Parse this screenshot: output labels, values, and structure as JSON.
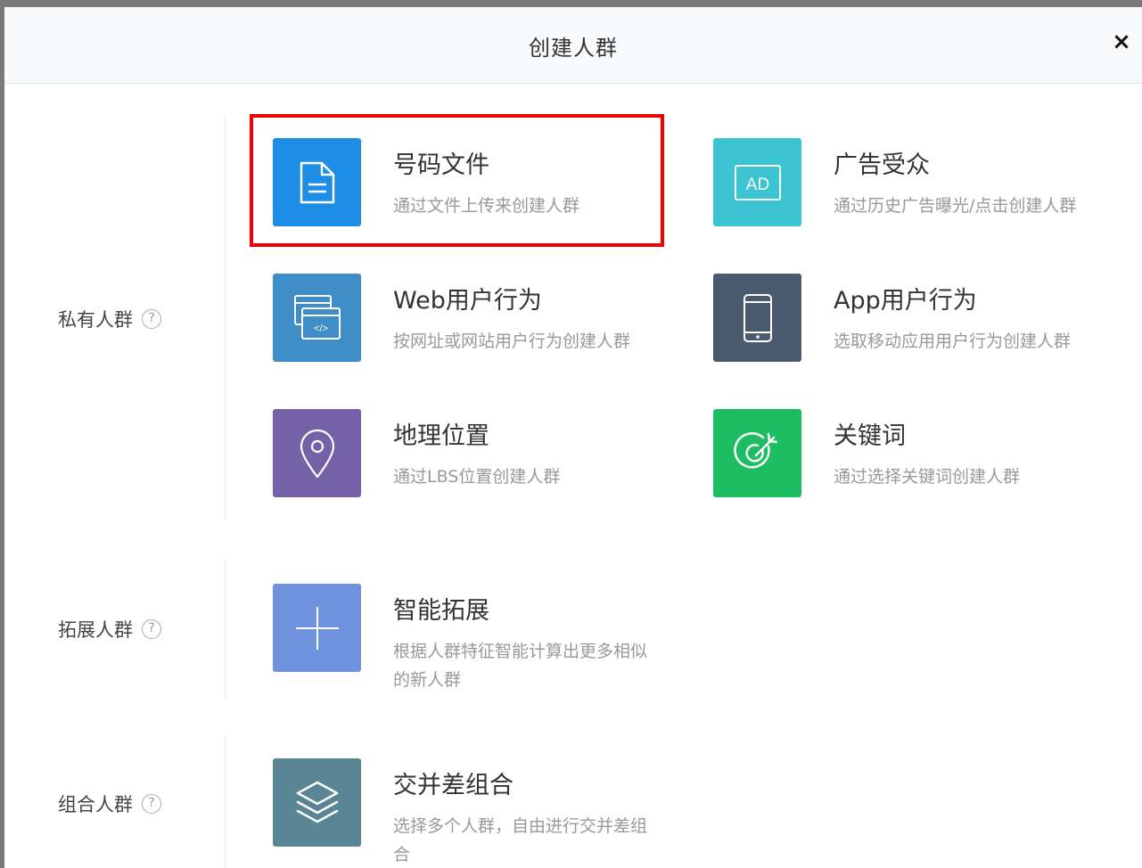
{
  "dialog": {
    "title": "创建人群",
    "close_label": "×"
  },
  "sections": {
    "private": {
      "label": "私有人群",
      "help": "?"
    },
    "expand": {
      "label": "拓展人群",
      "help": "?"
    },
    "combine": {
      "label": "组合人群",
      "help": "?"
    }
  },
  "cards": {
    "number_file": {
      "title": "号码文件",
      "desc": "通过文件上传来创建人群",
      "icon": "document-icon",
      "color": "#1e8de6"
    },
    "ad_audience": {
      "title": "广告受众",
      "desc": "通过历史广告曝光/点击创建人群",
      "icon": "ad-icon",
      "icon_text": "AD",
      "color": "#3cc4d2"
    },
    "web_behavior": {
      "title": "Web用户行为",
      "desc": "按网址或网站用户行为创建人群",
      "icon": "browser-code-icon",
      "icon_text": "</>",
      "color": "#3f8ec8"
    },
    "app_behavior": {
      "title": "App用户行为",
      "desc": "选取移动应用用户行为创建人群",
      "icon": "mobile-phone-icon",
      "color": "#4a5b6f"
    },
    "geo_location": {
      "title": "地理位置",
      "desc": "通过LBS位置创建人群",
      "icon": "map-pin-icon",
      "color": "#7462a8"
    },
    "keyword": {
      "title": "关键词",
      "desc": "通过选择关键词创建人群",
      "icon": "target-icon",
      "color": "#1dbe62"
    },
    "smart_expand": {
      "title": "智能拓展",
      "desc": "根据人群特征智能计算出更多相似的新人群",
      "icon": "plus-icon",
      "color": "#6f93dc"
    },
    "set_combine": {
      "title": "交并差组合",
      "desc": "选择多个人群，自由进行交并差组合",
      "icon": "layers-icon",
      "color": "#5a8594"
    }
  }
}
